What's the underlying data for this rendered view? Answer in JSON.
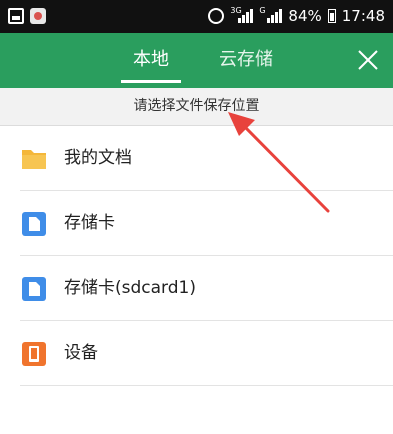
{
  "status_bar": {
    "left_icons": [
      "image-icon",
      "app-icon"
    ],
    "network_a": "3G",
    "network_b": "G",
    "battery": "84%",
    "time": "17:48"
  },
  "app_bar": {
    "tabs": [
      {
        "label": "本地",
        "active": true
      },
      {
        "label": "云存储",
        "active": false
      }
    ],
    "close_icon": "close-icon"
  },
  "hint": "请选择文件保存位置",
  "locations": [
    {
      "label": "我的文档",
      "icon": "folder-icon",
      "color": "#f4b73a"
    },
    {
      "label": "存储卡",
      "icon": "sd-card-icon",
      "color": "#3f8de8"
    },
    {
      "label": "存储卡(sdcard1)",
      "icon": "sd-card-icon",
      "color": "#3f8de8"
    },
    {
      "label": "设备",
      "icon": "device-icon",
      "color": "#f0742d"
    }
  ],
  "colors": {
    "app_bar": "#2a9e5e",
    "annotation_arrow": "#e8423c"
  }
}
